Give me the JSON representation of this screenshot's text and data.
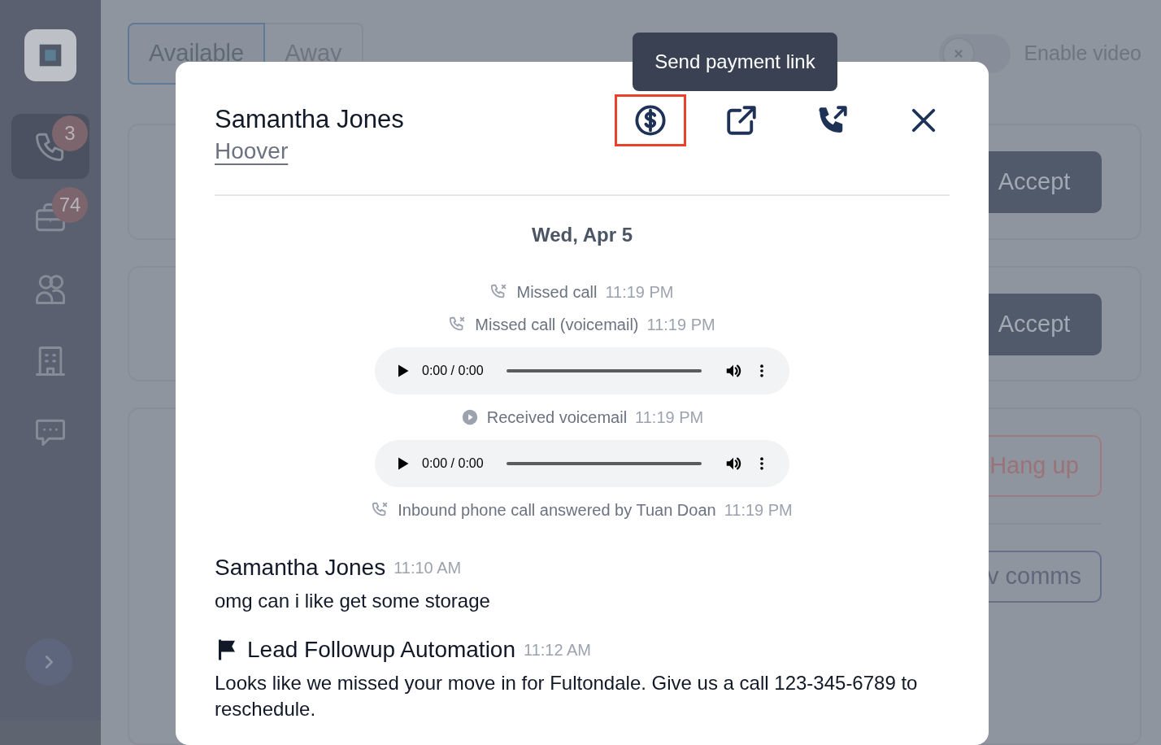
{
  "sidebar": {
    "items": [
      {
        "kind": "phone",
        "badge": "3",
        "selected": true
      },
      {
        "kind": "briefcase",
        "badge": "74",
        "selected": false
      },
      {
        "kind": "people",
        "selected": false
      },
      {
        "kind": "building",
        "selected": false
      },
      {
        "kind": "chat",
        "selected": false
      }
    ]
  },
  "status_tabs": [
    {
      "label": "Available",
      "selected": true
    },
    {
      "label": "Away",
      "selected": false
    }
  ],
  "video_toggle": {
    "label": "Enable video",
    "on": false
  },
  "background_buttons": [
    {
      "label": "Accept",
      "kind": "solid"
    },
    {
      "label": "Accept",
      "kind": "solid"
    },
    {
      "label": "Hang up",
      "kind": "danger"
    },
    {
      "label": "v comms",
      "kind": "outline"
    }
  ],
  "modal": {
    "title": "Samantha Jones",
    "subtitle": "Hoover",
    "tooltip": "Send payment link",
    "actions": [
      {
        "kind": "payment",
        "highlighted": true
      },
      {
        "kind": "external",
        "highlighted": false
      },
      {
        "kind": "transfer",
        "highlighted": false
      },
      {
        "kind": "close",
        "highlighted": false
      }
    ],
    "date": "Wed, Apr 5",
    "events": [
      {
        "kind": "missed",
        "text": "Missed call",
        "time": "11:19 PM"
      },
      {
        "kind": "missed",
        "text": "Missed call (voicemail)",
        "time": "11:19 PM"
      },
      {
        "kind": "audio",
        "reading": "0:00 / 0:00"
      },
      {
        "kind": "voicemail",
        "text": "Received voicemail",
        "time": "11:19 PM"
      },
      {
        "kind": "audio",
        "reading": "0:00 / 0:00"
      },
      {
        "kind": "missed",
        "text": "Inbound phone call answered by Tuan Doan",
        "time": "11:19 PM"
      }
    ],
    "messages": [
      {
        "author": "Samantha Jones",
        "time": "11:10 AM",
        "text": "omg can i like get some storage",
        "flag": false
      },
      {
        "author": "Lead Followup Automation",
        "time": "11:12 AM",
        "text": "Looks like we missed your move in for Fultondale. Give us a call 123-345-6789 to reschedule.",
        "flag": true
      }
    ]
  }
}
